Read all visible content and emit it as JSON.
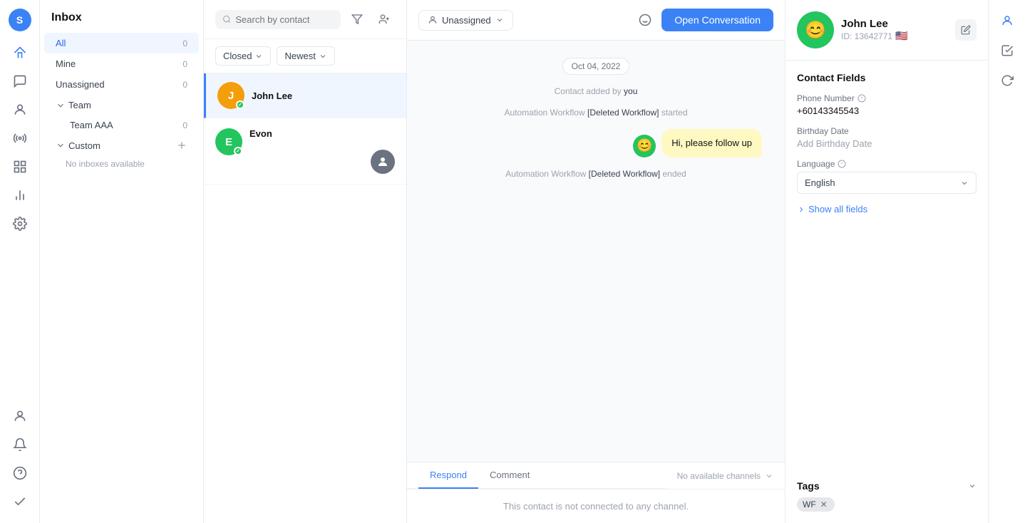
{
  "app": {
    "avatar_initials": "S"
  },
  "sidebar": {
    "title": "Inbox",
    "items": [
      {
        "id": "all",
        "label": "All",
        "count": "0",
        "active": true
      },
      {
        "id": "mine",
        "label": "Mine",
        "count": "0",
        "active": false
      },
      {
        "id": "unassigned",
        "label": "Unassigned",
        "count": "0",
        "active": false
      }
    ],
    "team_section": {
      "label": "Team",
      "sub_items": [
        {
          "label": "Team AAA",
          "count": "0"
        }
      ]
    },
    "custom_section": {
      "label": "Custom",
      "no_inbox": "No inboxes available"
    }
  },
  "conv_list": {
    "search_placeholder": "Search by contact",
    "filter_closed": "Closed",
    "filter_newest": "Newest",
    "items": [
      {
        "id": "john-lee",
        "name": "John Lee",
        "avatar_color": "#f59e0b",
        "active": true
      },
      {
        "id": "evon",
        "name": "Evon",
        "avatar_color": "#22c55e",
        "active": false
      }
    ]
  },
  "chat": {
    "assign_label": "Unassigned",
    "open_btn": "Open Conversation",
    "date_badge": "Oct 04, 2022",
    "system_messages": [
      "Contact added by you",
      "Automation Workflow [Deleted Workflow] started",
      "Automation Workflow [Deleted Workflow] ended"
    ],
    "message": {
      "text": "Hi, please follow up",
      "type": "sent"
    },
    "footer": {
      "tabs": [
        {
          "label": "Respond",
          "active": true
        },
        {
          "label": "Comment",
          "active": false
        }
      ],
      "no_channels": "No available channels",
      "body_text": "This contact is not connected to any channel."
    }
  },
  "contact": {
    "name": "John Lee",
    "id": "ID: 13642771",
    "emoji": "😊",
    "fields_title": "Contact Fields",
    "phone_label": "Phone Number",
    "phone_value": "+60143345543",
    "birthday_label": "Birthday Date",
    "birthday_placeholder": "Add Birthday Date",
    "language_label": "Language",
    "language_value": "English",
    "show_all": "Show all fields",
    "tags_label": "Tags",
    "tag_wf": "WF"
  }
}
